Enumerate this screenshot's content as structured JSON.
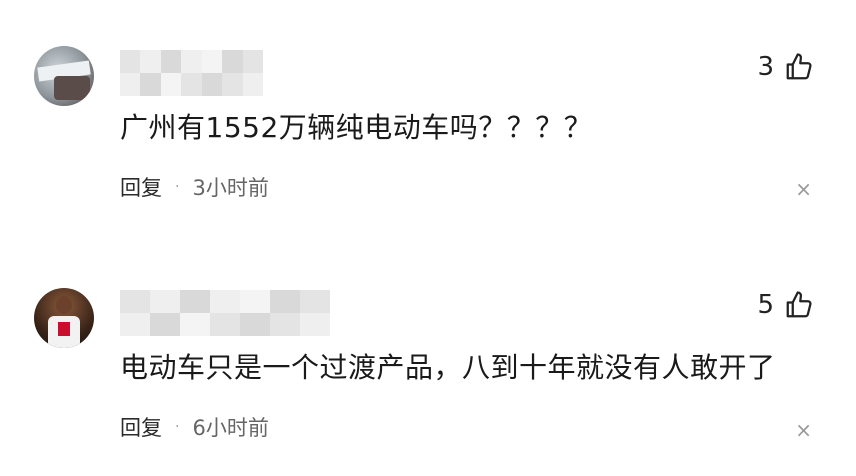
{
  "comments": [
    {
      "text": "广州有1552万辆纯电动车吗？？？？",
      "likes": "3",
      "reply_label": "回复",
      "separator": "·",
      "time": "3小时前",
      "close_icon": "×"
    },
    {
      "text": "电动车只是一个过渡产品，八到十年就没有人敢开了",
      "likes": "5",
      "reply_label": "回复",
      "separator": "·",
      "time": "6小时前",
      "close_icon": "×"
    }
  ],
  "icons": {
    "like": "thumbs-up-icon",
    "close": "close-icon"
  },
  "colors": {
    "text": "#1a1a1a",
    "meta": "#666666",
    "blur_block": "#e4e4e4"
  }
}
